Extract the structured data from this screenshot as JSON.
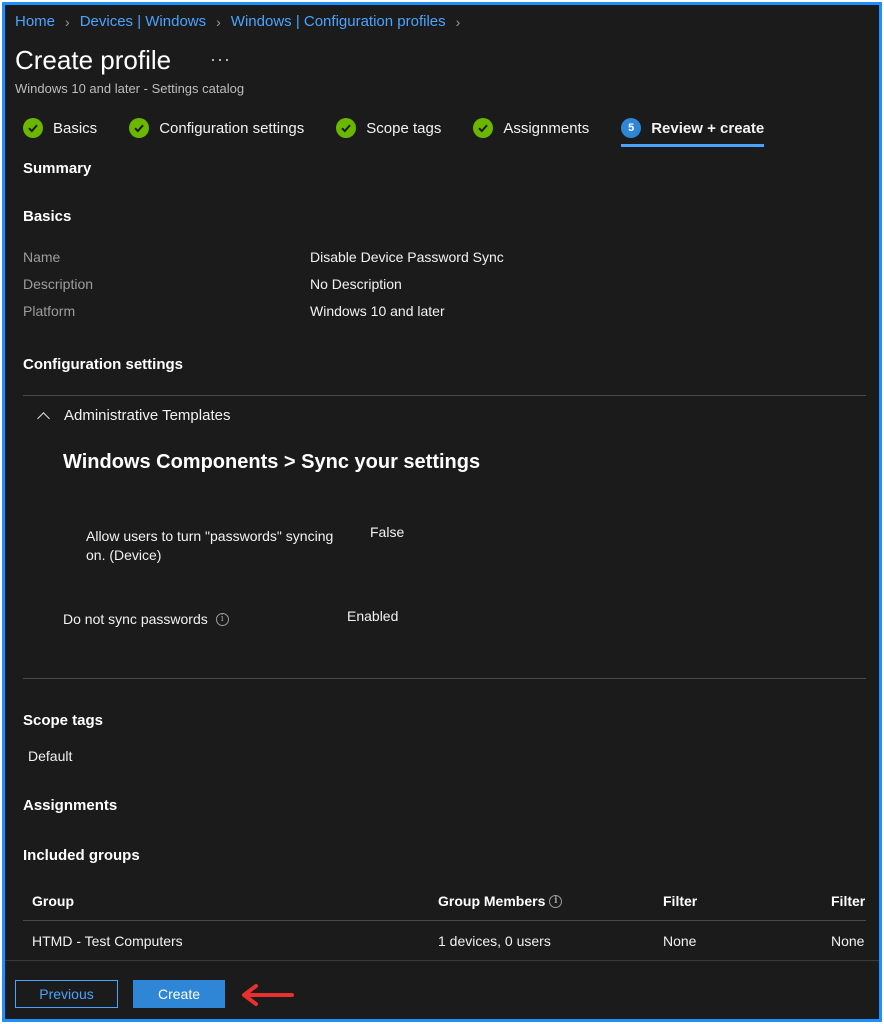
{
  "breadcrumb": {
    "items": [
      "Home",
      "Devices | Windows",
      "Windows | Configuration profiles"
    ]
  },
  "header": {
    "title": "Create profile",
    "more": "···",
    "subtitle": "Windows 10 and later - Settings catalog"
  },
  "steps": [
    {
      "label": "Basics",
      "state": "done"
    },
    {
      "label": "Configuration settings",
      "state": "done"
    },
    {
      "label": "Scope tags",
      "state": "done"
    },
    {
      "label": "Assignments",
      "state": "done"
    },
    {
      "label": "Review + create",
      "state": "active",
      "number": "5"
    }
  ],
  "summary": {
    "heading": "Summary",
    "basics_heading": "Basics",
    "fields": [
      {
        "label": "Name",
        "value": "Disable Device Password Sync"
      },
      {
        "label": "Description",
        "value": "No Description"
      },
      {
        "label": "Platform",
        "value": "Windows 10 and later"
      }
    ]
  },
  "config": {
    "heading": "Configuration settings",
    "group": "Administrative Templates",
    "category": "Windows Components > Sync your settings",
    "settings": [
      {
        "label": "Allow users to turn \"passwords\" syncing on. (Device)",
        "value": "False"
      },
      {
        "label": "Do not sync passwords",
        "value": "Enabled"
      }
    ]
  },
  "scope": {
    "heading": "Scope tags",
    "value": "Default"
  },
  "assignments": {
    "heading": "Assignments",
    "included_heading": "Included groups",
    "columns": [
      "Group",
      "Group Members",
      "Filter",
      "Filter"
    ],
    "rows": [
      {
        "group": "HTMD - Test Computers",
        "members": "1 devices, 0 users",
        "filter": "None",
        "filter2": "None"
      }
    ]
  },
  "footer": {
    "previous": "Previous",
    "create": "Create"
  },
  "colors": {
    "accent": "#4aa3ff",
    "success": "#6bb700",
    "primary_button": "#2f86d6",
    "annotation_arrow": "#e8312f",
    "frame_border": "#1e90ff"
  }
}
